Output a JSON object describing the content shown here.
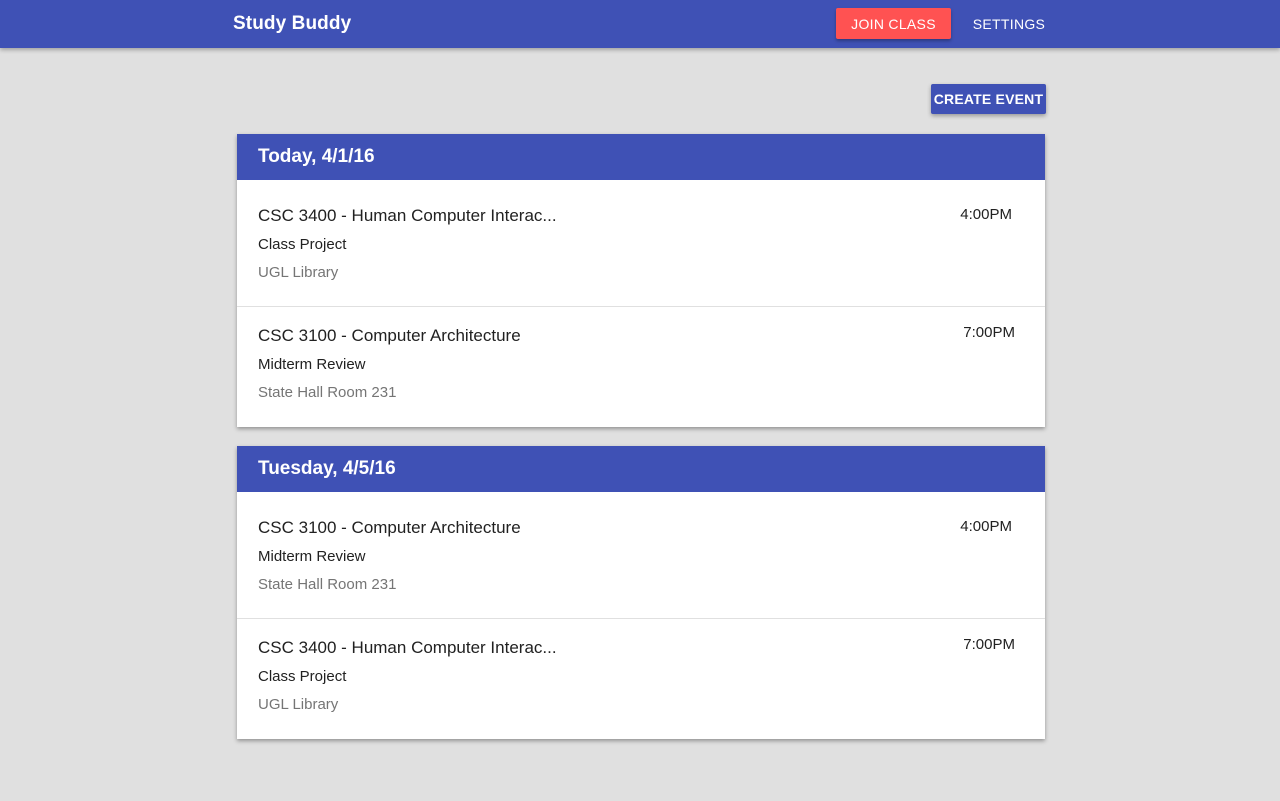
{
  "app": {
    "title": "Study Buddy",
    "join_label": "JOIN CLASS",
    "settings_label": "SETTINGS"
  },
  "toolbar": {
    "create_label": "CREATE EVENT"
  },
  "colors": {
    "primary": "#3f51b5",
    "accent": "#ff5252",
    "background": "#e0e0e0"
  },
  "days": [
    {
      "heading": "Today, 4/1/16",
      "events": [
        {
          "course": "CSC 3400 - Human Computer Interac...",
          "type": "Class Project",
          "location": "UGL Library",
          "time": "4:00PM"
        },
        {
          "course": "CSC 3100 - Computer Architecture",
          "type": "Midterm Review",
          "location": "State Hall Room 231",
          "time": "7:00PM"
        }
      ]
    },
    {
      "heading": "Tuesday, 4/5/16",
      "events": [
        {
          "course": "CSC 3100 - Computer Architecture",
          "type": "Midterm Review",
          "location": "State Hall Room 231",
          "time": "4:00PM"
        },
        {
          "course": "CSC 3400 - Human Computer Interac...",
          "type": "Class Project",
          "location": "UGL Library",
          "time": "7:00PM"
        }
      ]
    }
  ]
}
